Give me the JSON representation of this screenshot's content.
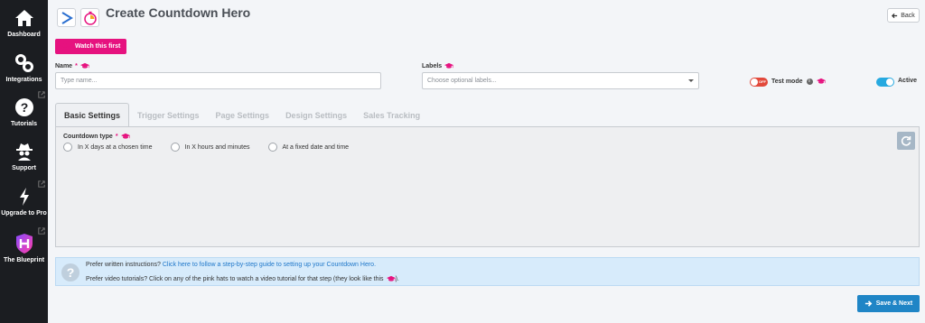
{
  "sidebar": {
    "items": [
      {
        "label": "Dashboard",
        "icon": "home-icon"
      },
      {
        "label": "Integrations",
        "icon": "link-icon"
      },
      {
        "label": "Tutorials",
        "icon": "question-icon",
        "external": true
      },
      {
        "label": "Support",
        "icon": "spy-icon"
      },
      {
        "label": "Upgrade to Pro",
        "icon": "lightning-icon",
        "external": true
      },
      {
        "label": "The Blueprint",
        "icon": "blueprint-shield-icon",
        "external": true
      }
    ]
  },
  "header": {
    "title": "Create Countdown Hero",
    "back_label": "Back",
    "watch_label": "Watch this first"
  },
  "form": {
    "name_label": "Name",
    "name_required_mark": "*",
    "name_placeholder": "Type name...",
    "labels_label": "Labels",
    "labels_placeholder": "Choose optional labels...",
    "test_mode_label": "Test mode",
    "test_mode_state": "OFF",
    "active_label": "Active"
  },
  "tabs": [
    "Basic Settings",
    "Trigger Settings",
    "Page Settings",
    "Design Settings",
    "Sales Tracking"
  ],
  "active_tab": "Basic Settings",
  "countdown": {
    "type_label": "Countdown type",
    "required_mark": "*",
    "options": [
      "In X days at a chosen time",
      "In X hours and minutes",
      "At a fixed date and time"
    ]
  },
  "info": {
    "line1_prefix": "Prefer written instructions?",
    "line1_link": "Click here to follow a step-by-step guide to setting up your Countdown Hero.",
    "line2_prefix": "Prefer video tutorials? Click on any of the pink hats to watch a video tutorial for that step (they look like this",
    "line2_suffix": ")."
  },
  "footer": {
    "save_label": "Save & Next"
  },
  "colors": {
    "sidebar_bg": "#1b1d21",
    "accent_pink": "#e6127f",
    "primary_blue": "#1f85c6",
    "toggle_on": "#26a9e0",
    "toggle_off": "#e2493b"
  }
}
